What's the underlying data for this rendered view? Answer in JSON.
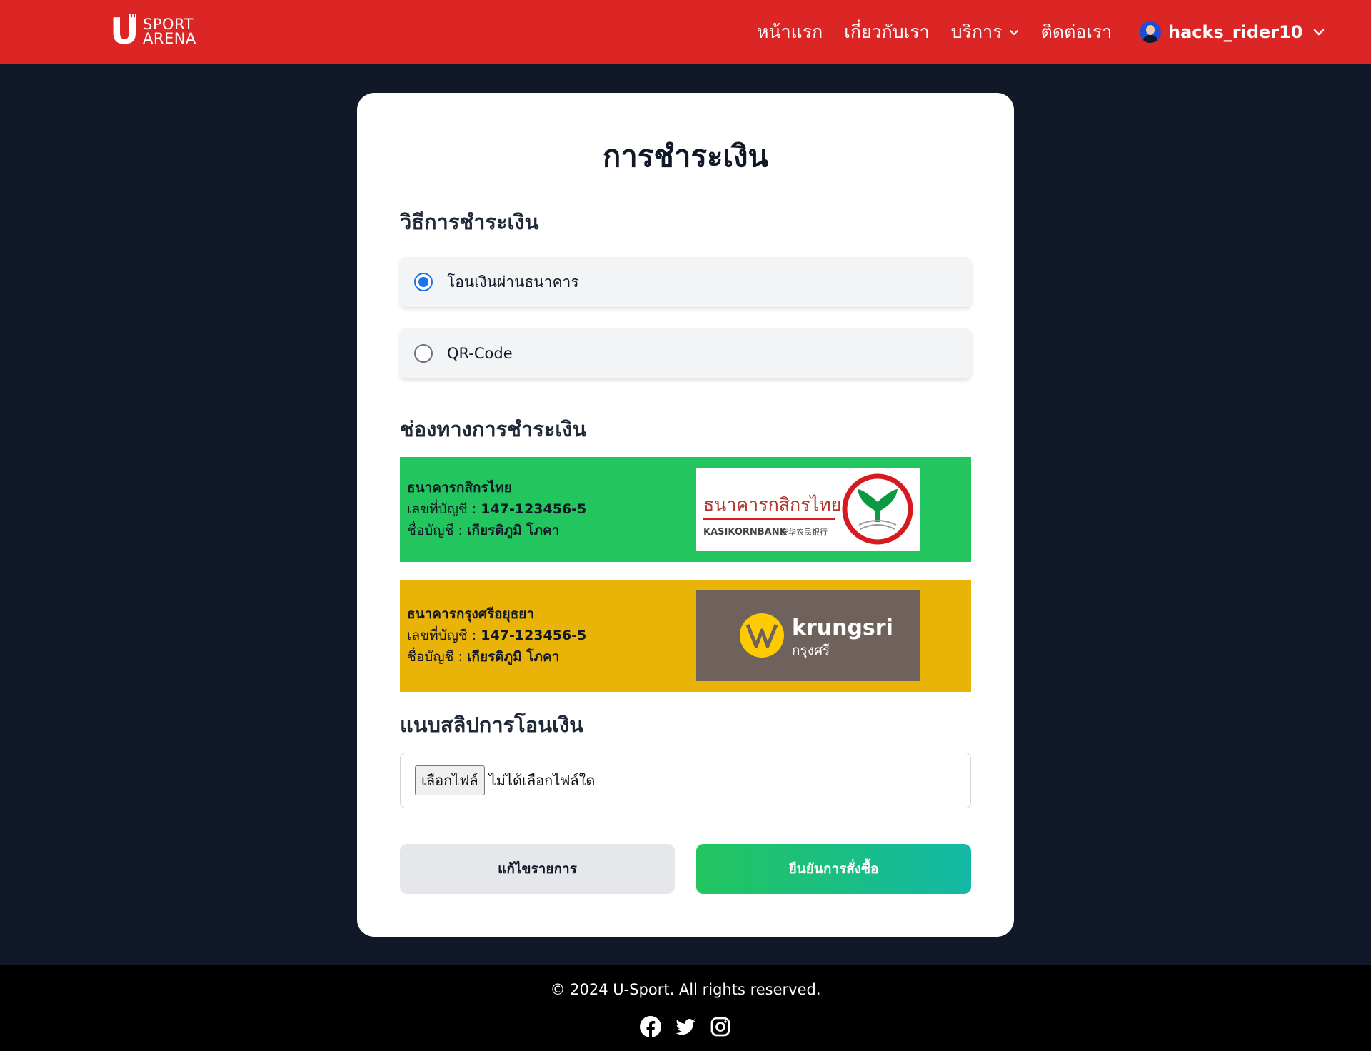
{
  "header": {
    "logo_line1": "SPORT",
    "logo_line2": "ARENA",
    "logo_letter": "U",
    "nav": {
      "home": "หน้าแรก",
      "about": "เกี่ยวกับเรา",
      "services": "บริการ",
      "contact": "ติดต่อเรา"
    },
    "username": "hacks_rider10"
  },
  "card": {
    "title": "การชำระเงิน",
    "method_title": "วิธีการชำระเงิน",
    "methods": [
      {
        "label": "โอนเงินผ่านธนาคาร",
        "checked": true
      },
      {
        "label": "QR-Code",
        "checked": false
      }
    ],
    "channel_title": "ช่องทางการชำระเงิน",
    "banks": [
      {
        "name": "ธนาคารกสิกรไทย",
        "account_label": "เลขที่บัญชี :",
        "account_number": "147-123456-5",
        "holder_label": "ชื่อบัญชี :",
        "holder_name": "เกียรติภูมิ โภคา",
        "bg_color": "#22c55e",
        "logo_text_th": "ธนาคารกสิกรไทย",
        "logo_text_en": "KASIKORNBANK",
        "logo_text_cn": "泰华农民银行"
      },
      {
        "name": "ธนาคารกรุงศรีอยุธยา",
        "account_label": "เลขที่บัญชี :",
        "account_number": "147-123456-5",
        "holder_label": "ชื่อบัญชี :",
        "holder_name": "เกียรติภูมิ โภคา",
        "bg_color": "#eab308",
        "logo_text_en": "krungsri",
        "logo_text_th": "กรุงศรี"
      }
    ],
    "slip_title": "แนบสลิปการโอนเงิน",
    "file_button": "เลือกไฟล์",
    "file_status": "ไม่ได้เลือกไฟล์ใด",
    "edit_button": "แก้ไขรายการ",
    "confirm_button": "ยืนยันการสั่งซื้อ"
  },
  "footer": {
    "copyright": "© 2024 U-Sport. All rights reserved.",
    "socials": [
      "facebook-icon",
      "twitter-icon",
      "instagram-icon"
    ]
  },
  "colors": {
    "header": "#dc2626",
    "page_bg": "#111827",
    "accent_radio": "#1a73e8"
  }
}
